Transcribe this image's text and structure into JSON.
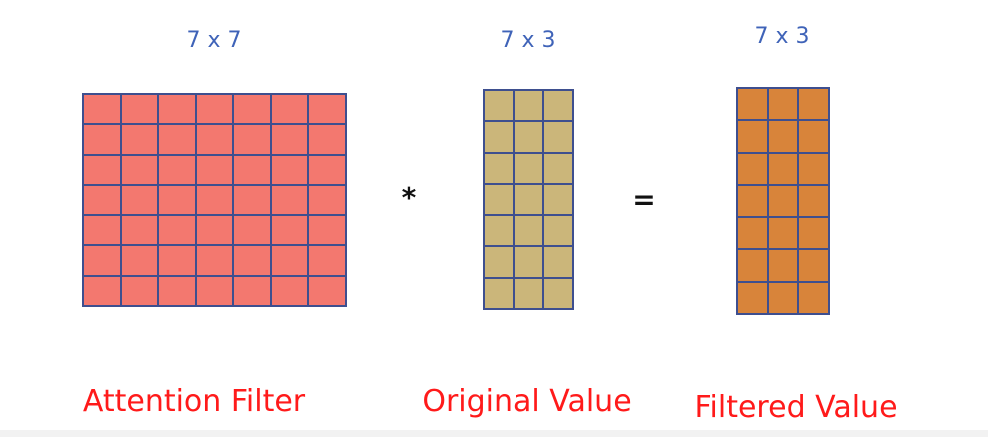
{
  "matrices": [
    {
      "id": "attention-filter",
      "dimension_label": "7 x 7",
      "caption": "Attention Filter",
      "rows": 7,
      "cols": 7,
      "fill_color": "#f3786f"
    },
    {
      "id": "original-value",
      "dimension_label": "7 x 3",
      "caption": "Original Value",
      "rows": 7,
      "cols": 3,
      "fill_color": "#cbb67a"
    },
    {
      "id": "filtered-value",
      "dimension_label": "7 x 3",
      "caption": "Filtered Value",
      "rows": 7,
      "cols": 3,
      "fill_color": "#d8843a"
    }
  ],
  "operators": {
    "multiply": "*",
    "equals": "="
  },
  "colors": {
    "grid_line": "#3e4f8f",
    "dimension_text": "#3f63b8",
    "caption_text": "#ff1a1a",
    "operator_text": "#111111"
  }
}
